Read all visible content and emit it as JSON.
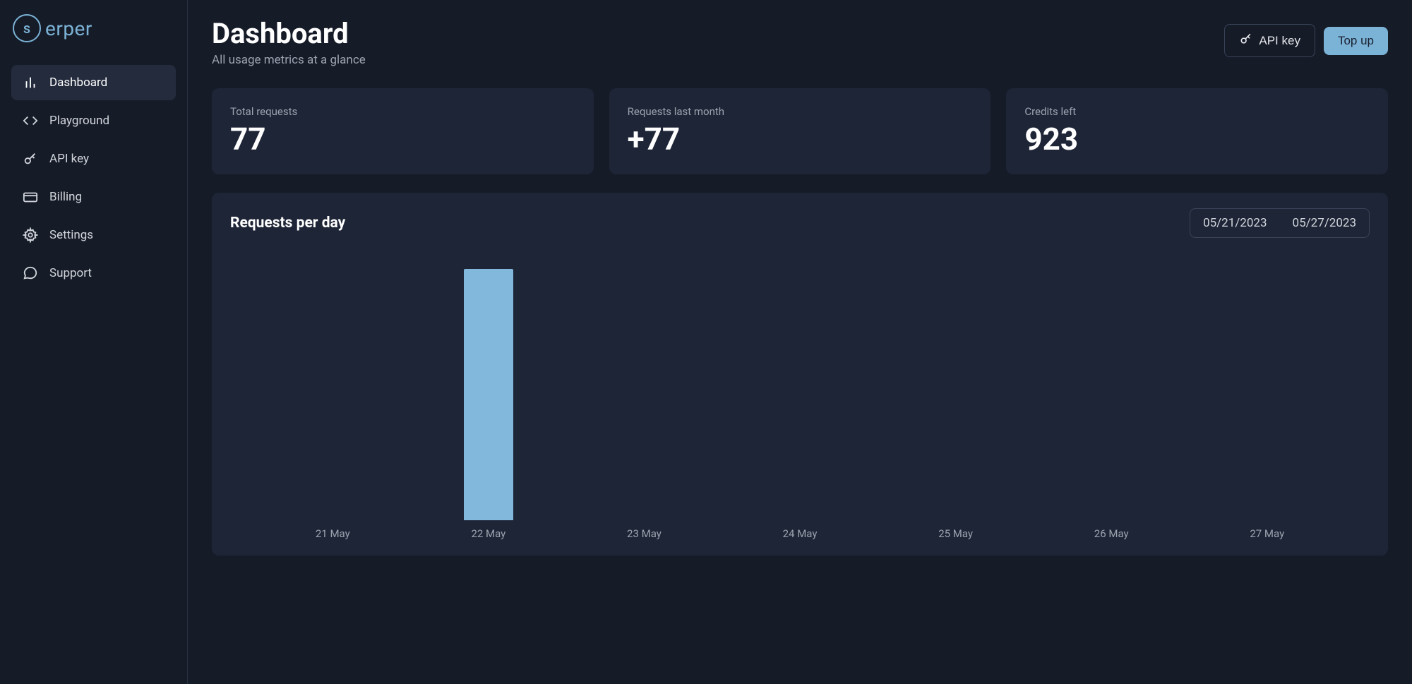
{
  "logo": {
    "mark": "s",
    "text": "erper"
  },
  "sidebar": {
    "items": [
      {
        "label": "Dashboard",
        "icon": "chart-bar"
      },
      {
        "label": "Playground",
        "icon": "code"
      },
      {
        "label": "API key",
        "icon": "key"
      },
      {
        "label": "Billing",
        "icon": "credit-card"
      },
      {
        "label": "Settings",
        "icon": "gear"
      },
      {
        "label": "Support",
        "icon": "chat"
      }
    ]
  },
  "header": {
    "title": "Dashboard",
    "subtitle": "All usage metrics at a glance",
    "api_key_label": "API key",
    "top_up_label": "Top up"
  },
  "stats": [
    {
      "label": "Total requests",
      "value": "77"
    },
    {
      "label": "Requests last month",
      "value": "+77"
    },
    {
      "label": "Credits left",
      "value": "923"
    }
  ],
  "chart": {
    "title": "Requests per day",
    "date_from": "05/21/2023",
    "date_to": "05/27/2023"
  },
  "chart_data": {
    "type": "bar",
    "categories": [
      "21 May",
      "22 May",
      "23 May",
      "24 May",
      "25 May",
      "26 May",
      "27 May"
    ],
    "values": [
      0,
      77,
      0,
      0,
      0,
      0,
      0
    ],
    "title": "Requests per day",
    "xlabel": "",
    "ylabel": "",
    "ylim": [
      0,
      80
    ]
  }
}
